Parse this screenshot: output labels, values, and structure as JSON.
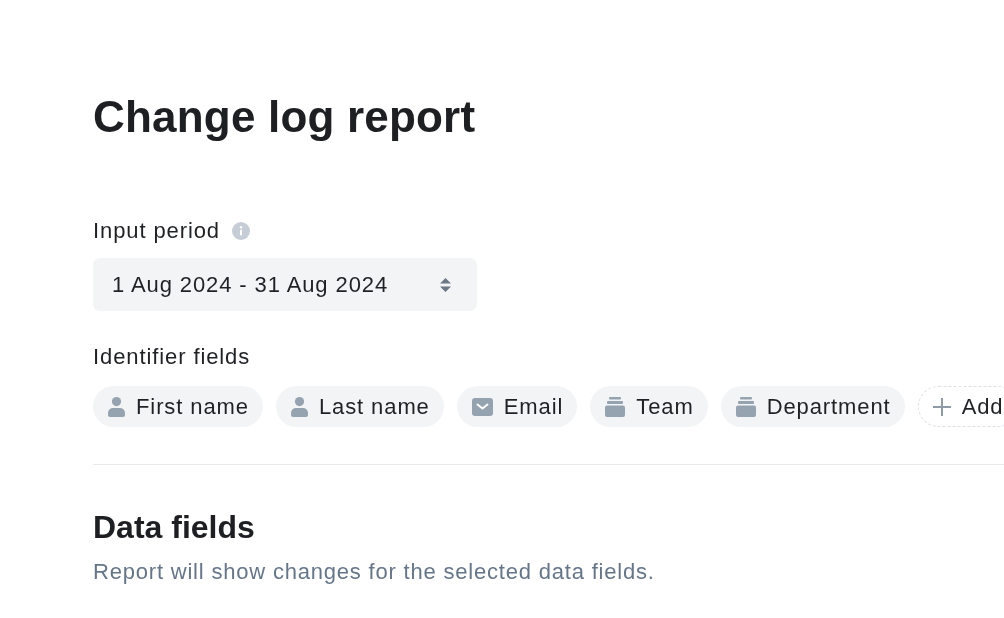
{
  "page": {
    "title": "Change log report"
  },
  "input_period": {
    "label": "Input period",
    "value": "1 Aug 2024 - 31 Aug 2024"
  },
  "identifier_fields": {
    "label": "Identifier fields",
    "chips": [
      {
        "label": "First name",
        "kind": "person"
      },
      {
        "label": "Last name",
        "kind": "person"
      },
      {
        "label": "Email",
        "kind": "email"
      },
      {
        "label": "Team",
        "kind": "group"
      },
      {
        "label": "Department",
        "kind": "group"
      }
    ],
    "add_button": {
      "label": "Add"
    }
  },
  "data_fields": {
    "title": "Data fields",
    "description": "Report will show changes for the selected data fields."
  }
}
